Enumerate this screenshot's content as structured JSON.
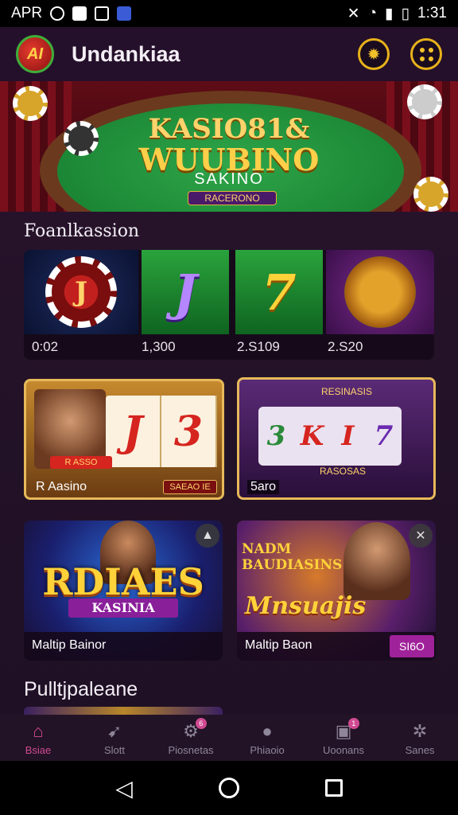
{
  "status_bar": {
    "left_text": "APR",
    "time": "1:31"
  },
  "header": {
    "app_title": "Undankiaa",
    "logo_text": "AI"
  },
  "hero": {
    "line1": "KASIO81&",
    "line2": "WUUBINO",
    "tagline": "SAKINO",
    "badge": "RACERONO"
  },
  "section1_title": "Foanlkassion",
  "featured": [
    {
      "label": "0:02",
      "icon": "J"
    },
    {
      "label": "1,300",
      "icon": "J"
    },
    {
      "label": "2.S109",
      "icon": "7"
    },
    {
      "label": "2.S20",
      "icon": "lion-icon"
    }
  ],
  "card_a": {
    "face_banner": "R ASSO",
    "reels": [
      "J",
      "3"
    ],
    "label": "R Aasino",
    "badge": "SAEAO IE"
  },
  "card_b": {
    "top_banner": "RESINASIS",
    "slots": [
      "3",
      "K",
      "I",
      "7"
    ],
    "bottom_banner": "RASOSAS",
    "label": "5aro"
  },
  "card_c": {
    "logo": "RDIAES",
    "sub": "KASINIA",
    "label": "Maltip Bainor"
  },
  "card_d": {
    "logo_top": "NADM BAUDIASINS",
    "logo_main": "Mnsuajis",
    "label": "Maltip Baon",
    "pill": "SI6O"
  },
  "section2_title": "Pulltjpaleane",
  "bottom_nav": [
    {
      "label": "Bsiae",
      "icon": "home-icon",
      "active": true
    },
    {
      "label": "Slott",
      "icon": "slot-icon",
      "active": false
    },
    {
      "label": "Piosnetas",
      "icon": "gear-icon",
      "active": false,
      "badge": "6"
    },
    {
      "label": "Phiaoio",
      "icon": "user-icon",
      "active": false
    },
    {
      "label": "Uoonans",
      "icon": "ticket-icon",
      "active": false,
      "badge": "1"
    },
    {
      "label": "Sanes",
      "icon": "cog-icon",
      "active": false
    }
  ]
}
